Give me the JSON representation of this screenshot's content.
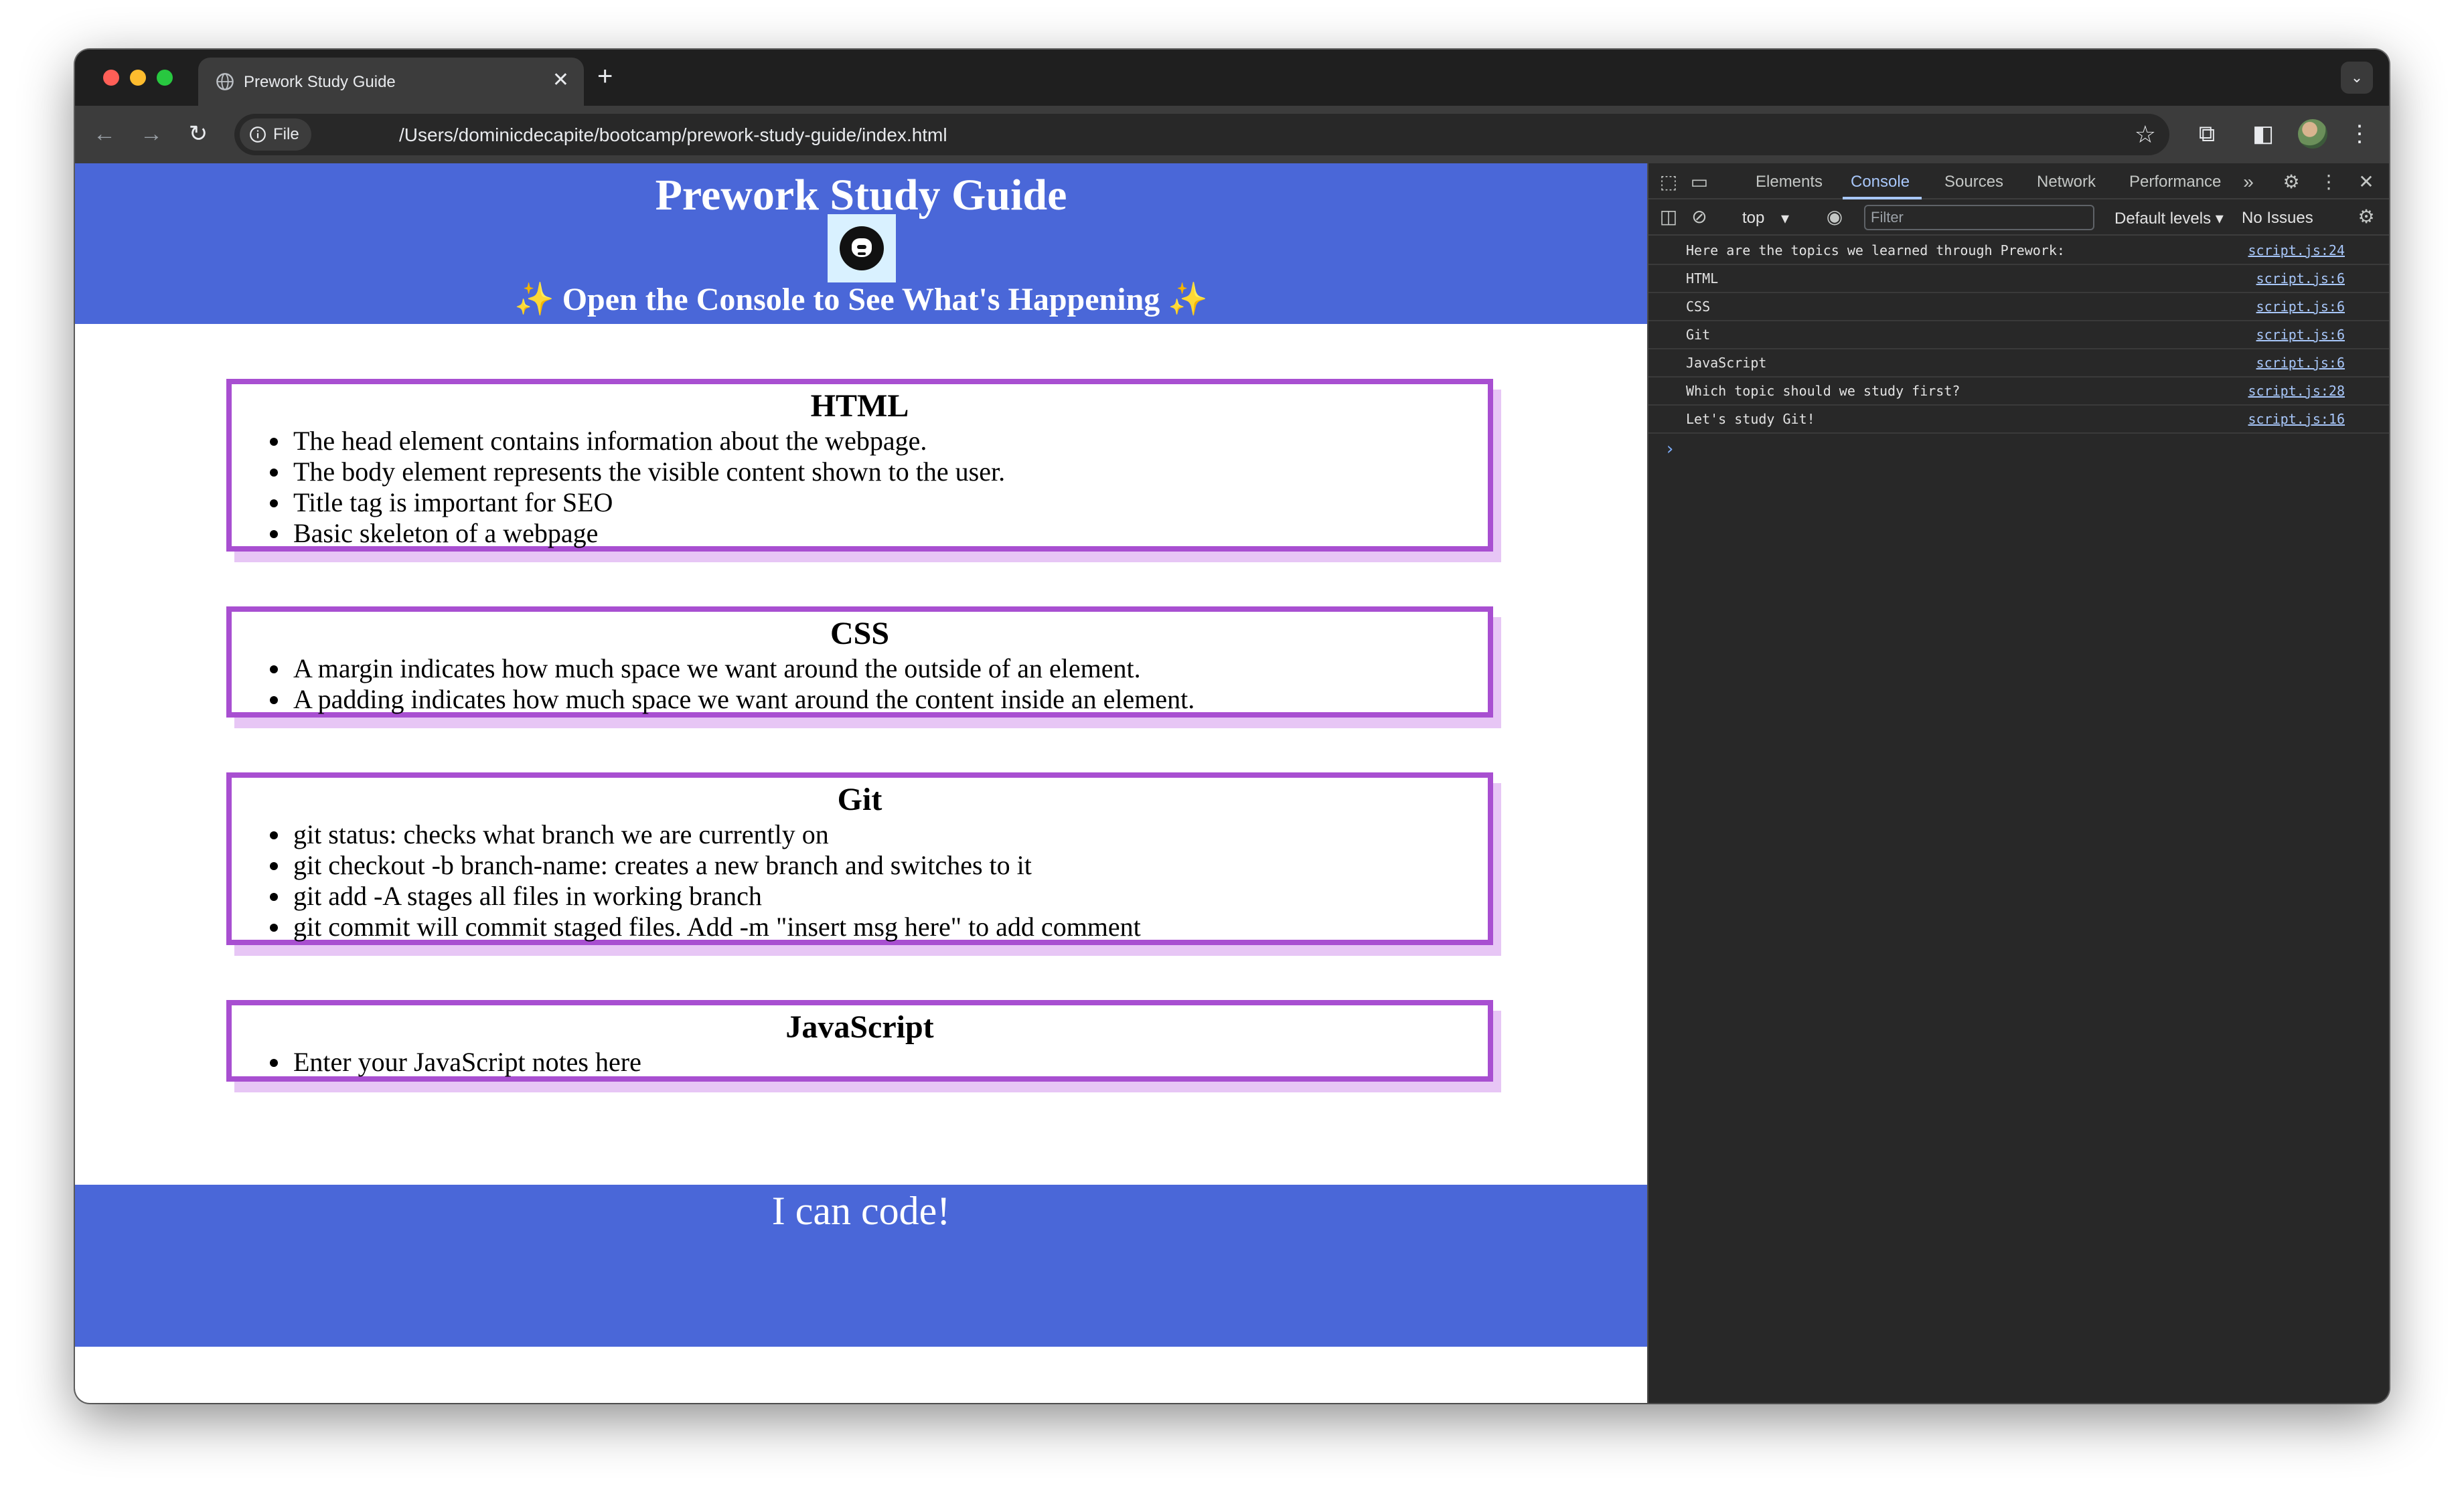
{
  "browser": {
    "tab_title": "Prework Study Guide",
    "tab_close": "✕",
    "new_tab": "+",
    "tab_menu": "⌄",
    "chip_label": "File",
    "url": "/Users/dominicdecapite/bootcamp/prework-study-guide/index.html"
  },
  "page": {
    "title": "Prework Study Guide",
    "subtitle": "✨ Open the Console to See What's Happening ✨",
    "footer": "I can code!",
    "colors": {
      "header_bg": "#4a67d8",
      "card_border": "#a84fd1",
      "card_shadow": "#e7c6f5"
    },
    "sections": [
      {
        "heading": "HTML",
        "items": [
          "The head element contains information about the webpage.",
          "The body element represents the visible content shown to the user.",
          "Title tag is important for SEO",
          "Basic skeleton of a webpage"
        ]
      },
      {
        "heading": "CSS",
        "items": [
          "A margin indicates how much space we want around the outside of an element.",
          "A padding indicates how much space we want around the content inside an element."
        ]
      },
      {
        "heading": "Git",
        "items": [
          "git status: checks what branch we are currently on",
          "git checkout -b branch-name: creates a new branch and switches to it",
          "git add -A stages all files in working branch",
          "git commit will commit staged files. Add -m \"insert msg here\" to add comment"
        ]
      },
      {
        "heading": "JavaScript",
        "items": [
          "Enter your JavaScript notes here"
        ]
      }
    ]
  },
  "devtools": {
    "tabs": [
      "Elements",
      "Console",
      "Sources",
      "Network",
      "Performance"
    ],
    "active_tab": "Console",
    "context": "top",
    "filter_placeholder": "Filter",
    "levels": "Default levels ▾",
    "issues": "No Issues",
    "logs": [
      {
        "message": "Here are the topics we learned through Prework:",
        "source": "script.js:24"
      },
      {
        "message": "HTML",
        "source": "script.js:6"
      },
      {
        "message": "CSS",
        "source": "script.js:6"
      },
      {
        "message": "Git",
        "source": "script.js:6"
      },
      {
        "message": "JavaScript",
        "source": "script.js:6"
      },
      {
        "message": "Which topic should we study first?",
        "source": "script.js:28"
      },
      {
        "message": "Let's study Git!",
        "source": "script.js:16"
      }
    ],
    "prompt": "›"
  }
}
